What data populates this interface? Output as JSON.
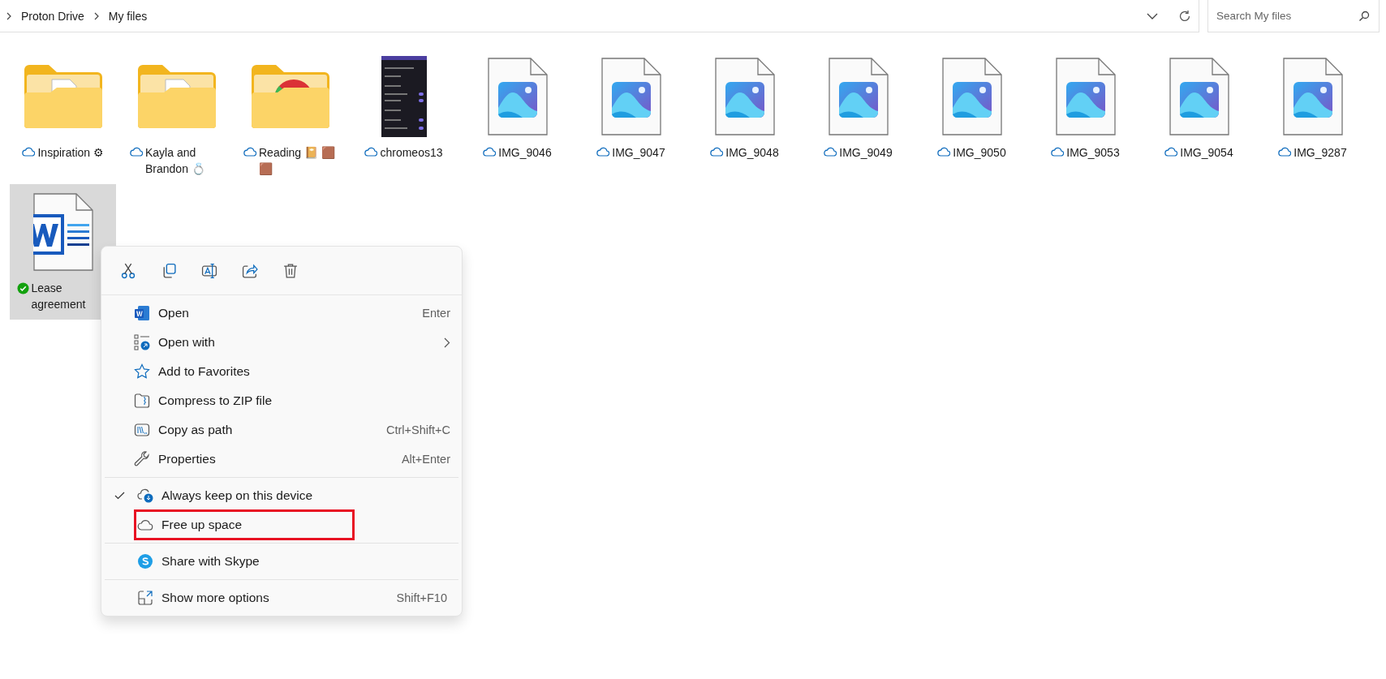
{
  "address_bar": {
    "breadcrumbs": [
      {
        "label": "Proton Drive"
      },
      {
        "label": "My files"
      }
    ]
  },
  "search": {
    "placeholder": "Search My files"
  },
  "files": [
    {
      "name": "Inspiration ⚙",
      "kind": "folder",
      "synced": false,
      "selected": false
    },
    {
      "name": "Kayla and Brandon 💍",
      "kind": "folder",
      "synced": false,
      "selected": false
    },
    {
      "name": "Reading 📔 🟫 🟫",
      "kind": "folder-web",
      "synced": false,
      "selected": false
    },
    {
      "name": "chromeos13",
      "kind": "screenshot",
      "synced": false,
      "selected": false
    },
    {
      "name": "IMG_9046",
      "kind": "image",
      "synced": false,
      "selected": false
    },
    {
      "name": "IMG_9047",
      "kind": "image",
      "synced": false,
      "selected": false
    },
    {
      "name": "IMG_9048",
      "kind": "image",
      "synced": false,
      "selected": false
    },
    {
      "name": "IMG_9049",
      "kind": "image",
      "synced": false,
      "selected": false
    },
    {
      "name": "IMG_9050",
      "kind": "image",
      "synced": false,
      "selected": false
    },
    {
      "name": "IMG_9053",
      "kind": "image",
      "synced": false,
      "selected": false
    },
    {
      "name": "IMG_9054",
      "kind": "image",
      "synced": false,
      "selected": false
    },
    {
      "name": "IMG_9287",
      "kind": "image",
      "synced": false,
      "selected": false
    },
    {
      "name": "Lease agreement",
      "kind": "word",
      "synced": true,
      "selected": true
    }
  ],
  "context_menu": {
    "sections": [
      [
        {
          "label": "Open",
          "shortcut": "Enter",
          "submenu": false,
          "checked": false,
          "highlighted": false
        },
        {
          "label": "Open with",
          "submenu": true,
          "checked": false,
          "highlighted": false
        },
        {
          "label": "Add to Favorites",
          "submenu": false,
          "checked": false,
          "highlighted": false
        },
        {
          "label": "Compress to ZIP file",
          "submenu": false,
          "checked": false,
          "highlighted": false
        },
        {
          "label": "Copy as path",
          "shortcut": "Ctrl+Shift+C",
          "submenu": false,
          "checked": false,
          "highlighted": false
        },
        {
          "label": "Properties",
          "shortcut": "Alt+Enter",
          "submenu": false,
          "checked": false,
          "highlighted": false
        }
      ],
      [
        {
          "label": "Always keep on this device",
          "submenu": false,
          "checked": true,
          "highlighted": false
        },
        {
          "label": "Free up space",
          "submenu": false,
          "checked": false,
          "highlighted": true
        }
      ],
      [
        {
          "label": "Share with Skype",
          "submenu": false,
          "checked": false,
          "highlighted": false
        }
      ],
      [
        {
          "label": "Show more options",
          "shortcut": "Shift+F10",
          "submenu": false,
          "checked": false,
          "highlighted": false
        }
      ]
    ]
  }
}
